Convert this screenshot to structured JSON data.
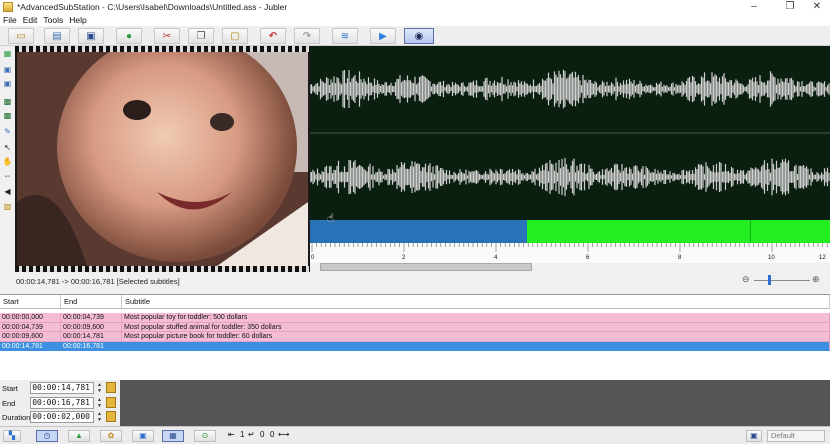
{
  "window": {
    "title": "*AdvancedSubStation - C:\\Users\\Isabel\\Downloads\\Untitled.ass - Jubler",
    "minimize_glyph": "–",
    "maximize_glyph": "❐",
    "close_glyph": "✕"
  },
  "menu": {
    "items": [
      "File",
      "Edit",
      "Tools",
      "Help"
    ]
  },
  "toolbar": {
    "buttons": [
      {
        "name": "new-file-icon",
        "glyph": "▭"
      },
      {
        "name": "open-file-icon",
        "glyph": "▤"
      },
      {
        "name": "save-icon",
        "glyph": "▣"
      },
      {
        "name": "info-icon",
        "glyph": "●"
      },
      {
        "name": "cut-icon",
        "glyph": "✂"
      },
      {
        "name": "copy-icon",
        "glyph": "❐"
      },
      {
        "name": "paste-icon",
        "glyph": "▢"
      },
      {
        "name": "undo-icon",
        "glyph": "↶"
      },
      {
        "name": "redo-icon",
        "glyph": "↷"
      },
      {
        "name": "sort-icon",
        "glyph": "≋"
      },
      {
        "name": "play-icon",
        "glyph": "▶"
      },
      {
        "name": "preview-eye-icon",
        "glyph": "◉"
      }
    ]
  },
  "ruler": {
    "ticks": [
      "0",
      "2",
      "4",
      "6",
      "8",
      "10",
      "12"
    ]
  },
  "preview": {
    "time_info": "00:00:14,781 -> 00:00:16,781 [Selected subtitles]",
    "zoom_out_glyph": "⊖",
    "zoom_in_glyph": "⊕"
  },
  "table": {
    "columns": [
      "Start",
      "End",
      "Subtitle"
    ],
    "rows": [
      {
        "start": "00:00:00,000",
        "end": "00:00:04,739",
        "text": "Most popular toy for toddler: 500 dollars",
        "selected": false
      },
      {
        "start": "00:00:04,739",
        "end": "00:00:09,600",
        "text": "Most popular stuffed animal for toddler: 350 dollars",
        "selected": false
      },
      {
        "start": "00:00:09,600",
        "end": "00:00:14,781",
        "text": "Most popular picture book for toddler: 60 dollars",
        "selected": false
      },
      {
        "start": "00:00:14,781",
        "end": "00:00:16,781",
        "text": "",
        "selected": true
      }
    ]
  },
  "editor": {
    "start_label": "Start",
    "start_value": "00:00:14,781",
    "end_label": "End",
    "end_value": "00:00:16,781",
    "duration_label": "Duration",
    "duration_value": "00:00:02,000",
    "spin_up_glyph": "▲",
    "spin_down_glyph": "▼",
    "lock_glyph": "🔒"
  },
  "statusbar": {
    "style_dropdown": "Default",
    "newline_glyph": "↵",
    "wrap_glyph": "⇤",
    "arrows_glyph": "⟷",
    "counters": [
      "1",
      "0",
      "0"
    ]
  },
  "colors": {
    "waveform_bg": "#0b1f10",
    "waveform": "#cfcfcf",
    "subtitle_bar": "#22ee22",
    "subtitle_selected": "#2a72b8",
    "row_pink": "#f5bcd6",
    "row_selected": "#3d8fe0"
  }
}
